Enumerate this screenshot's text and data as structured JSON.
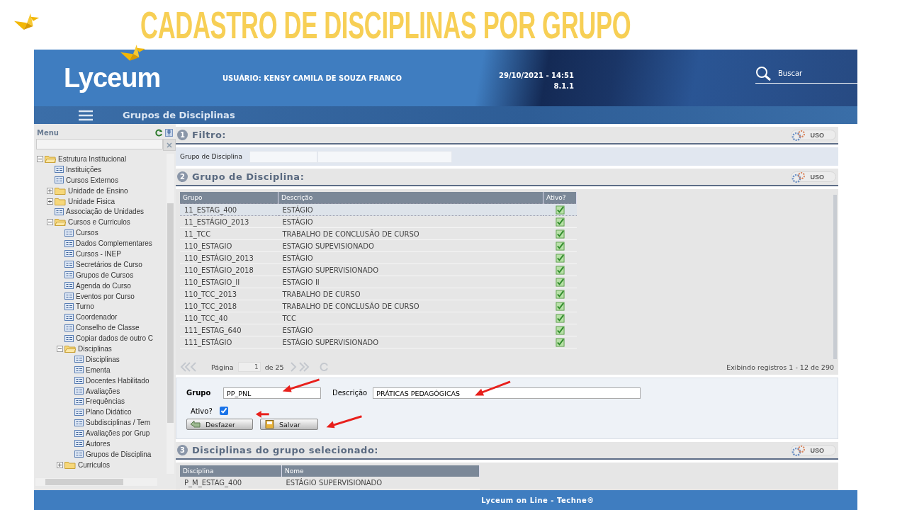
{
  "slide": {
    "title": "CADASTRO DE DISCIPLINAS POR GRUPO"
  },
  "header": {
    "logo": "Lyceum",
    "user": "USUÁRIO: KENSY CAMILA DE SOUZA FRANCO",
    "datetime": "29/10/2021 - 14:51",
    "version": "8.1.1",
    "search": {
      "placeholder": "Buscar"
    }
  },
  "nav": {
    "title": "Grupos de Disciplinas"
  },
  "sidebar": {
    "title": "Menu",
    "tree": [
      {
        "label": "Estrutura Institucional",
        "kind": "folder",
        "expanded": true,
        "children": [
          {
            "label": "Instituições",
            "kind": "page"
          },
          {
            "label": "Cursos Externos",
            "kind": "page"
          },
          {
            "label": "Unidade de Ensino",
            "kind": "folder",
            "expanded": false
          },
          {
            "label": "Unidade Fisica",
            "kind": "folder",
            "expanded": false
          },
          {
            "label": "Associação de Unidades",
            "kind": "page"
          },
          {
            "label": "Cursos e Curriculos",
            "kind": "folder",
            "expanded": true,
            "children": [
              {
                "label": "Cursos",
                "kind": "page"
              },
              {
                "label": "Dados Complementares",
                "kind": "page"
              },
              {
                "label": "Cursos - INEP",
                "kind": "page"
              },
              {
                "label": "Secretários de Curso",
                "kind": "page"
              },
              {
                "label": "Grupos de Cursos",
                "kind": "page"
              },
              {
                "label": "Agenda do Curso",
                "kind": "page"
              },
              {
                "label": "Eventos por Curso",
                "kind": "page"
              },
              {
                "label": "Turno",
                "kind": "page"
              },
              {
                "label": "Coordenador",
                "kind": "page"
              },
              {
                "label": "Conselho de Classe",
                "kind": "page"
              },
              {
                "label": "Copiar dados de outro C",
                "kind": "page"
              },
              {
                "label": "Disciplinas",
                "kind": "folder",
                "expanded": true,
                "children": [
                  {
                    "label": "Disciplinas",
                    "kind": "page"
                  },
                  {
                    "label": "Ementa",
                    "kind": "page"
                  },
                  {
                    "label": "Docentes Habilitado",
                    "kind": "page"
                  },
                  {
                    "label": "Avaliações",
                    "kind": "page"
                  },
                  {
                    "label": "Frequências",
                    "kind": "page"
                  },
                  {
                    "label": "Plano Didático",
                    "kind": "page"
                  },
                  {
                    "label": "Subdisciplinas / Tem",
                    "kind": "page"
                  },
                  {
                    "label": "Avaliações por Grup",
                    "kind": "page"
                  },
                  {
                    "label": "Autores",
                    "kind": "page"
                  },
                  {
                    "label": "Grupos de Disciplina",
                    "kind": "page"
                  }
                ]
              },
              {
                "label": "Curriculos",
                "kind": "folder",
                "expanded": false
              }
            ]
          }
        ]
      }
    ]
  },
  "filter": {
    "number": "1",
    "title": "Filtro:",
    "toggle": "USO",
    "label": "Grupo de Disciplina"
  },
  "groups": {
    "number": "2",
    "title": "Grupo de Disciplina:",
    "toggle": "USO",
    "columns": [
      "Grupo",
      "Descrição",
      "Ativo?"
    ],
    "rows": [
      {
        "grupo": "11_ESTAG_400",
        "descricao": "ESTÁGIO",
        "active": true,
        "selected": true
      },
      {
        "grupo": "11_ESTÁGIO_2013",
        "descricao": "ESTÁGIO",
        "active": true,
        "selected": false
      },
      {
        "grupo": "11_TCC",
        "descricao": "TRABALHO DE CONCLUSÃO DE CURSO",
        "active": true,
        "selected": false
      },
      {
        "grupo": "110_ESTAGIO",
        "descricao": "ESTAGIO SUPEVISIONADO",
        "active": true,
        "selected": false
      },
      {
        "grupo": "110_ESTÁGIO_2013",
        "descricao": "ESTÁGIO",
        "active": true,
        "selected": false
      },
      {
        "grupo": "110_ESTÁGIO_2018",
        "descricao": "ESTÁGIO SUPERVISIONADO",
        "active": true,
        "selected": false
      },
      {
        "grupo": "110_ESTAGIO_II",
        "descricao": "ESTAGIO II",
        "active": true,
        "selected": false
      },
      {
        "grupo": "110_TCC_2013",
        "descricao": "TRABALHO DE CURSO",
        "active": true,
        "selected": false
      },
      {
        "grupo": "110_TCC_2018",
        "descricao": "TRABALHO DE CONCLUSÃO DE CURSO",
        "active": true,
        "selected": false
      },
      {
        "grupo": "110_TCC_40",
        "descricao": "TCC",
        "active": true,
        "selected": false
      },
      {
        "grupo": "111_ESTAG_640",
        "descricao": "ESTÁGIO",
        "active": true,
        "selected": false
      },
      {
        "grupo": "111_ESTÁGIO",
        "descricao": "ESTÁGIO SUPERVISIONADO",
        "active": true,
        "selected": false
      }
    ],
    "pager": {
      "label": "Página",
      "page": "1",
      "total": "de 25",
      "summary": "Exibindo registros 1 - 12 de 290"
    }
  },
  "form": {
    "fields": [
      {
        "label": "Grupo",
        "value": "PP_PNL"
      },
      {
        "label": "Descrição",
        "value": "PRÁTICAS PEDAGÓGICAS"
      }
    ],
    "active": {
      "label": "Ativo?",
      "checked": true
    },
    "buttons": [
      "Desfazer",
      "Salvar"
    ]
  },
  "members": {
    "number": "3",
    "title": "Disciplinas do grupo selecionado:",
    "toggle": "USO",
    "columns": [
      "Disciplina",
      "Nome"
    ],
    "rows": [
      {
        "disciplina": "P_M_ESTAG_400",
        "nome": "ESTÁGIO SUPERVISIONADO"
      }
    ]
  },
  "footer": {
    "text": "Lyceum on Line - Techne®"
  }
}
